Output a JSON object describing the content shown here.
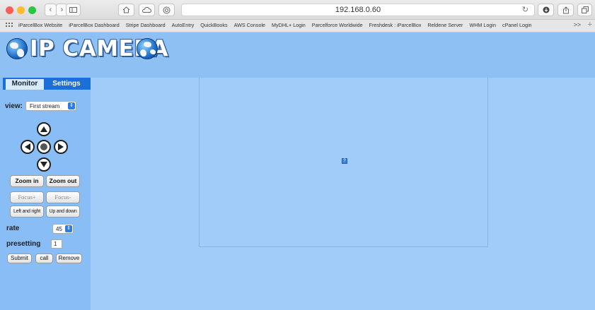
{
  "browser": {
    "url": "192.168.0.60",
    "icons": [
      "back-icon",
      "forward-icon",
      "sidebar-icon",
      "home-icon",
      "cloud-icon",
      "privacy-icon",
      "reload-icon",
      "download-icon",
      "share-icon",
      "tabs-icon"
    ],
    "bookmarks": [
      "iParcelBox Website",
      "iParcelBox Dashboard",
      "Stripe Dashboard",
      "AutoEntry",
      "QuickBooks",
      "AWS Console",
      "MyDHL+ Login",
      "Parcelforce Worldwide",
      "Freshdesk : iParcelBox",
      "Reldene Server",
      "WHM Login",
      "cPanel Login"
    ],
    "more": ">>",
    "add": "+"
  },
  "header": {
    "logo": "IP CAMERA"
  },
  "sidebar": {
    "tabs": [
      "Monitor",
      "Settings"
    ],
    "view_label": "view:",
    "view_value": "First stream",
    "zoom_in": "Zoom in",
    "zoom_out": "Zoom out",
    "focus_plus": "Focus+",
    "focus_minus": "Focus-",
    "left_right": "Left and right",
    "up_down": "Up and down",
    "rate_label": "rate",
    "rate_value": "45",
    "presetting_label": "presetting",
    "presetting_value": "1",
    "submit": "Submit",
    "call": "call",
    "remove": "Remove"
  },
  "colors": {
    "accent": "#1a6fd8",
    "page_bg": "#9ec9f7"
  }
}
